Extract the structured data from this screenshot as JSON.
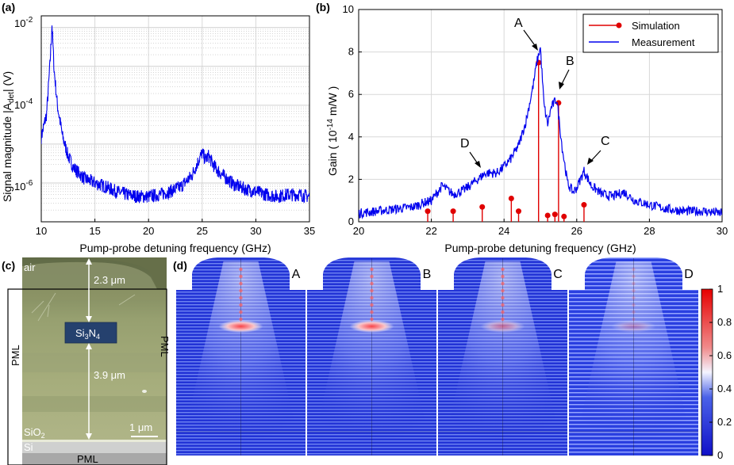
{
  "panels": {
    "a": {
      "label": "(a)",
      "ylabel": "Signal magnitude |A",
      "ylabel_sub": "det",
      "ylabel_end": "| (V)",
      "xlabel": "Pump-probe detuning frequency (GHz)"
    },
    "b": {
      "label": "(b)",
      "ylabel": "Gain ( 10",
      "ylabel_sup": "-14",
      "ylabel_end": " m/W )",
      "xlabel": "Pump-probe detuning frequency (GHz)",
      "annotations": [
        "A",
        "B",
        "C",
        "D"
      ]
    },
    "c": {
      "label": "(c)",
      "texts": {
        "air": "air",
        "dim1": "2.3 μm",
        "core_a": "Si",
        "core_sub3": "3",
        "core_b": "N",
        "core_sub4": "4",
        "pml_left": "PML",
        "pml_right": "PML",
        "dim2": "3.9 μm",
        "sio2_a": "SiO",
        "sio2_sub": "2",
        "si": "Si",
        "pml_bottom": "PML",
        "scale": "1 μm"
      }
    },
    "d": {
      "label": "(d)",
      "maps": [
        "A",
        "B",
        "C",
        "D"
      ],
      "colorbar_ticks": [
        "1",
        "0.8",
        "0.6",
        "0.4",
        "0.2",
        "0"
      ]
    }
  },
  "chart_data": [
    {
      "type": "line",
      "panel": "a",
      "title": "",
      "xlabel": "Pump-probe detuning frequency (GHz)",
      "ylabel": "Signal magnitude |Adet| (V)",
      "xlim": [
        10,
        35
      ],
      "ylim": [
        1e-07,
        0.02
      ],
      "yscale": "log",
      "grid": true,
      "x_ticks": [
        "10",
        "15",
        "20",
        "25",
        "30",
        "35"
      ],
      "y_ticks": [
        {
          "base": "10",
          "exp": "-2",
          "value": 0.01
        },
        {
          "base": "10",
          "exp": "-4",
          "value": 0.0001
        },
        {
          "base": "10",
          "exp": "-6",
          "value": 1e-06
        }
      ],
      "series": [
        {
          "color": "#0000ff",
          "x": [
            10.0,
            10.5,
            10.8,
            10.95,
            11.0,
            11.05,
            11.2,
            11.5,
            12.0,
            12.5,
            13.0,
            14.0,
            15.0,
            16.0,
            17.0,
            18.0,
            19.0,
            20.0,
            21.0,
            22.0,
            23.0,
            24.0,
            24.5,
            25.0,
            25.3,
            25.6,
            26.0,
            26.5,
            27.0,
            28.0,
            29.0,
            30.0,
            31.0,
            32.0,
            33.0,
            34.0,
            35.0
          ],
          "y": [
            1.5e-05,
            6e-05,
            0.001,
            0.006,
            0.012,
            0.006,
            0.0008,
            0.0001,
            1.5e-05,
            5e-06,
            2.5e-06,
            1.3e-06,
            1e-06,
            8e-07,
            6e-07,
            5e-07,
            4.5e-07,
            4.5e-07,
            5e-07,
            6e-07,
            8e-07,
            1.5e-06,
            3e-06,
            6e-06,
            4e-06,
            5e-06,
            3e-06,
            2e-06,
            1.5e-06,
            9e-07,
            7e-07,
            6e-07,
            5e-07,
            4.5e-07,
            5e-07,
            5e-07,
            4.5e-07
          ]
        }
      ]
    },
    {
      "type": "line",
      "panel": "b",
      "title": "",
      "xlabel": "Pump-probe detuning frequency (GHz)",
      "ylabel": "Gain ( 10^-14 m/W )",
      "xlim": [
        20,
        30
      ],
      "ylim": [
        0,
        10
      ],
      "grid": true,
      "legend_position": "top-right",
      "x_ticks": [
        "20",
        "22",
        "24",
        "26",
        "28",
        "30"
      ],
      "y_ticks": [
        "0",
        "2",
        "4",
        "6",
        "8",
        "10"
      ],
      "series": [
        {
          "name": "Measurement",
          "color": "#0000ff",
          "x": [
            20.0,
            20.5,
            21.0,
            21.5,
            21.8,
            22.0,
            22.3,
            22.6,
            22.9,
            23.2,
            23.5,
            23.8,
            24.0,
            24.2,
            24.4,
            24.6,
            24.8,
            24.9,
            25.0,
            25.1,
            25.2,
            25.3,
            25.45,
            25.6,
            25.75,
            25.9,
            26.0,
            26.2,
            26.4,
            26.7,
            27.0,
            27.3,
            27.6,
            28.0,
            28.5,
            29.0,
            29.5,
            30.0
          ],
          "y": [
            0.4,
            0.5,
            0.6,
            0.7,
            0.9,
            1.0,
            1.7,
            1.3,
            1.5,
            1.9,
            2.3,
            2.3,
            2.6,
            3.0,
            3.6,
            4.7,
            6.4,
            7.5,
            8.2,
            5.5,
            4.6,
            5.4,
            5.8,
            3.5,
            1.8,
            1.4,
            1.6,
            2.4,
            1.7,
            1.3,
            1.2,
            1.4,
            1.0,
            0.8,
            0.6,
            0.5,
            0.5,
            0.4
          ]
        },
        {
          "name": "Simulation",
          "type": "stem",
          "color": "#e00000",
          "x": [
            21.9,
            22.6,
            23.4,
            24.2,
            24.4,
            24.95,
            25.2,
            25.4,
            25.5,
            25.65,
            26.2
          ],
          "y": [
            0.5,
            0.5,
            0.7,
            1.1,
            0.5,
            7.5,
            0.3,
            0.35,
            5.6,
            0.25,
            0.8
          ]
        }
      ]
    }
  ]
}
